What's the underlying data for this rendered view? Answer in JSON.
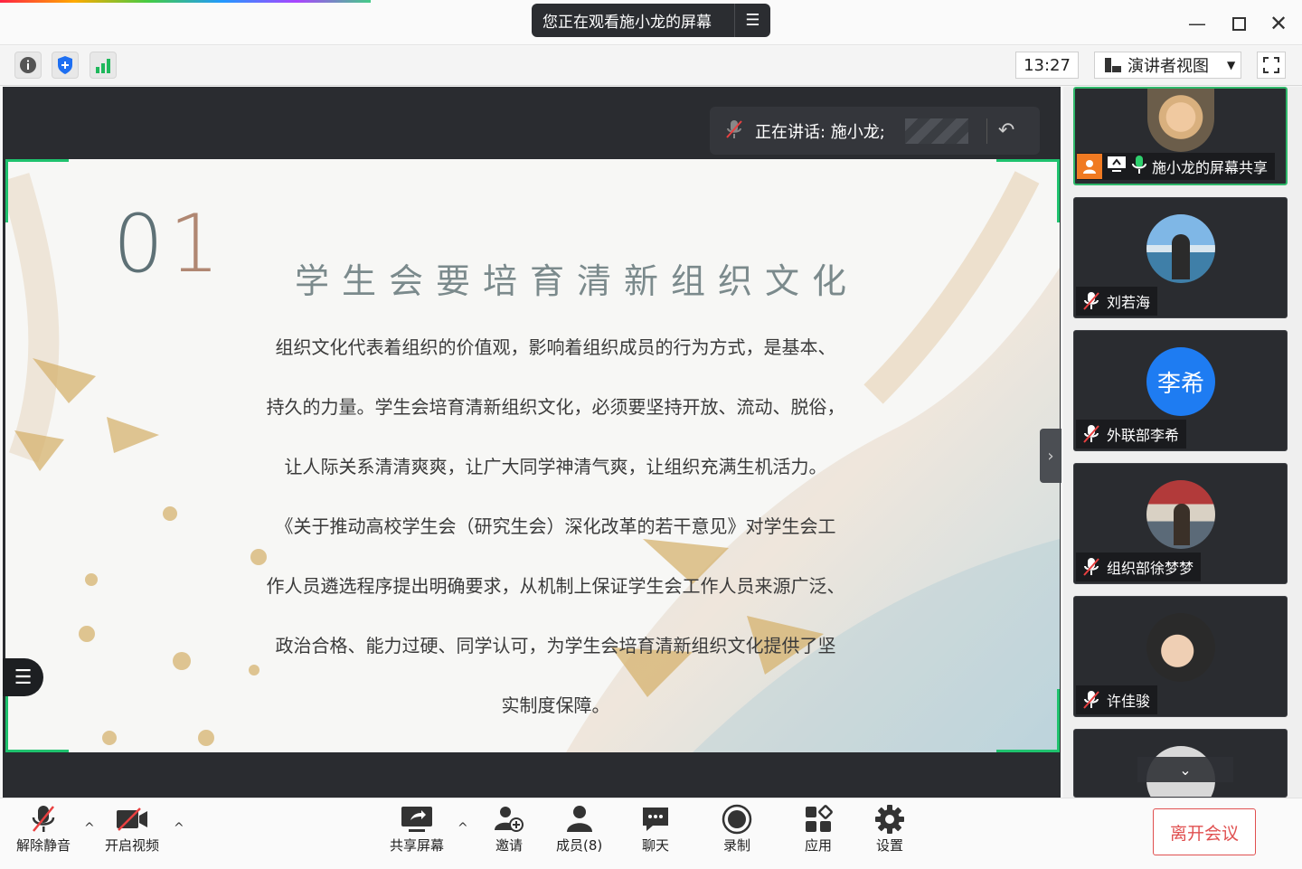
{
  "window": {
    "title": "您正在观看施小龙的屏幕"
  },
  "toolbar": {
    "time": "13:27",
    "view_mode": "演讲者视图"
  },
  "stage": {
    "speaker_label": "正在讲话: 施小龙;"
  },
  "slide": {
    "number_a": "0",
    "number_b": "1",
    "title": "学生会要培育清新组织文化",
    "lines": [
      "组织文化代表着组织的价值观，影响着组织成员的行为方式，是基本、",
      "持久的力量。学生会培育清新组织文化，必须要坚持开放、流动、脱俗，",
      "让人际关系清清爽爽，让广大同学神清气爽，让组织充满生机活力。",
      "《关于推动高校学生会（研究生会）深化改革的若干意见》对学生会工",
      "作人员遴选程序提出明确要求，从机制上保证学生会工作人员来源广泛、",
      "政治合格、能力过硬、同学认可，为学生会培育清新组织文化提供了坚",
      "实制度保障。"
    ]
  },
  "participants": [
    {
      "name": "施小龙的屏幕共享",
      "avatar_text": "",
      "status": "speaking"
    },
    {
      "name": "刘若海",
      "avatar_text": "",
      "status": "muted"
    },
    {
      "name": "外联部李希",
      "avatar_text": "李希",
      "status": "muted"
    },
    {
      "name": "组织部徐梦梦",
      "avatar_text": "",
      "status": "muted"
    },
    {
      "name": "许佳骏",
      "avatar_text": "",
      "status": "muted"
    }
  ],
  "bottombar": {
    "unmute": "解除静音",
    "start_video": "开启视频",
    "share_screen": "共享屏幕",
    "invite": "邀请",
    "members": "成员(8)",
    "chat": "聊天",
    "record": "录制",
    "apps": "应用",
    "settings": "设置",
    "leave": "离开会议"
  },
  "colors": {
    "accent_green": "#1fc26e",
    "leave_red": "#e05050",
    "avatar_blue": "#1e7cf2",
    "share_orange": "#f07a22"
  }
}
